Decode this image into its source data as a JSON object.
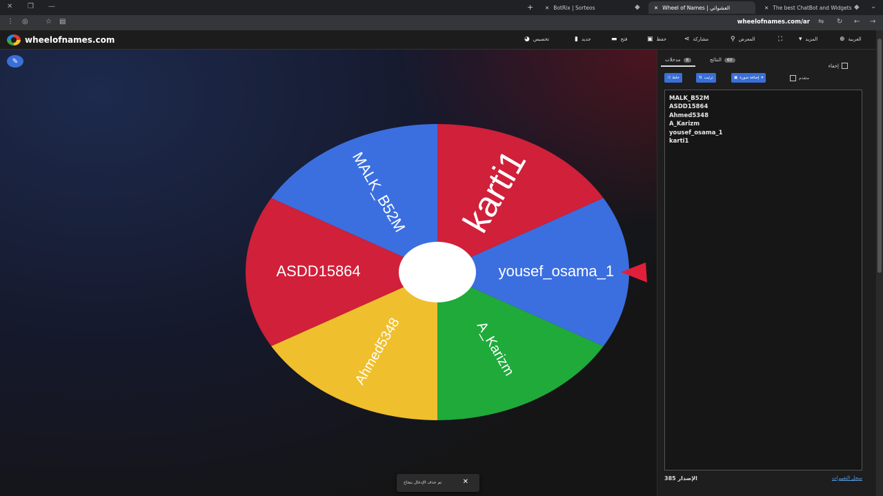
{
  "browser": {
    "tabs": [
      {
        "title": "BotRix | Sorteos"
      },
      {
        "title": "Wheel of Names | العشوائي"
      },
      {
        "title": "The best ChatBot and Widgets"
      }
    ],
    "url": "wheelofnames.com/ar"
  },
  "app": {
    "logo_text": "wheelofnames.com",
    "menu": [
      {
        "label": "تخصيص",
        "icon": "palette-icon"
      },
      {
        "label": "جديد",
        "icon": "file-icon"
      },
      {
        "label": "فتح",
        "icon": "folder-icon"
      },
      {
        "label": "حفظ",
        "icon": "save-icon"
      },
      {
        "label": "مشاركة",
        "icon": "share-icon"
      },
      {
        "label": "المعرض",
        "icon": "search-icon"
      },
      {
        "label": "",
        "icon": "fullscreen-icon"
      },
      {
        "label": "المزيد",
        "icon": "caret-down-icon"
      },
      {
        "label": "العربية",
        "icon": "globe-icon"
      }
    ]
  },
  "wheel": {
    "segments": [
      {
        "label": "karti1",
        "color": "#d0203a"
      },
      {
        "label": "MALK_B52M",
        "color": "#3b6fe0"
      },
      {
        "label": "ASDD15864",
        "color": "#d0203a"
      },
      {
        "label": "Ahmed5348",
        "color": "#efbf2d"
      },
      {
        "label": "A_Karizm",
        "color": "#1faa3a"
      },
      {
        "label": "yousef_osama_1",
        "color": "#3b6fe0"
      }
    ],
    "pointer_color": "#e0203a"
  },
  "panel": {
    "tabs": {
      "entries_label": "مدخلات",
      "entries_count": "6",
      "results_label": "النتائج",
      "results_count": "60"
    },
    "hide_label": "إخفاء",
    "toolbar": {
      "shuffle_label": "خلط",
      "sort_label": "ترتيب",
      "add_image_label": "إضافة صورة",
      "advanced_label": "متقدم"
    },
    "entries": [
      "MALK_B52M",
      "ASDD15864",
      "Ahmed5348",
      "A_Karizm",
      "yousef_osama_1",
      "karti1"
    ],
    "version": "الإصدار 385",
    "changelog": "سجل التغييرات"
  },
  "toast": {
    "message": "تم حذف الإدخال بنجاح"
  }
}
